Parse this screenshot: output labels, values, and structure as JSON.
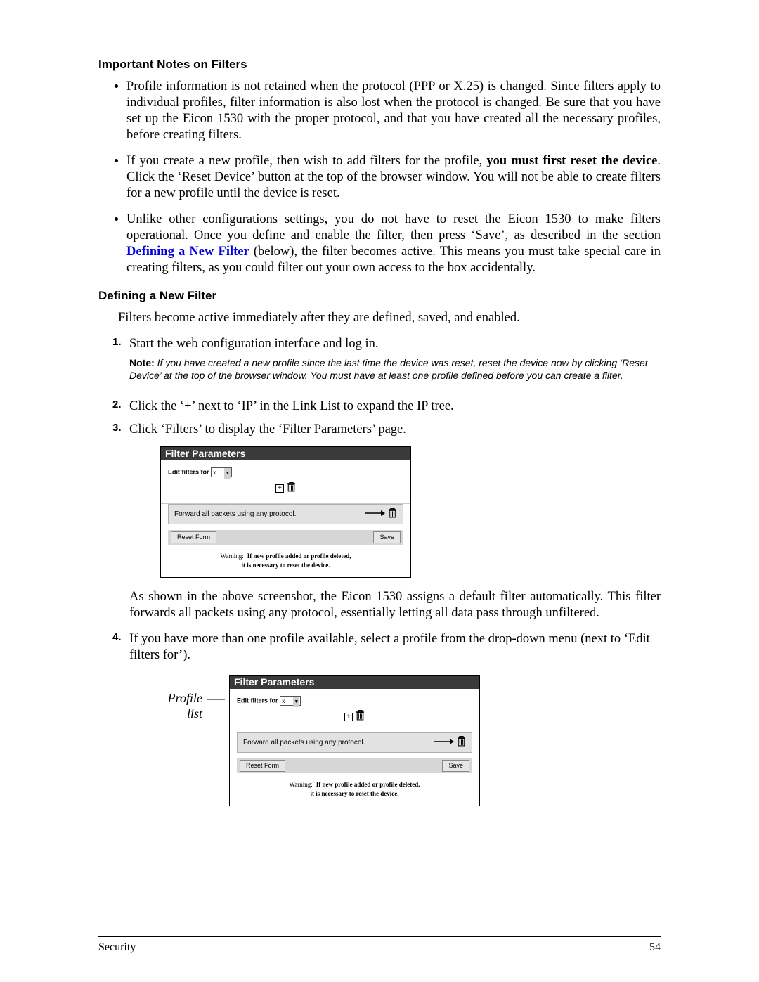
{
  "headings": {
    "notes": "Important Notes on Filters",
    "defining": "Defining a New Filter"
  },
  "bullets": [
    {
      "text": "Profile information is not retained when the protocol (PPP or X.25) is changed. Since filters apply to individual profiles, filter information is also lost when the protocol is changed. Be sure that you have set up the Eicon 1530 with the proper protocol, and that you have created all the necessary profiles, before creating filters."
    },
    {
      "pre": "If you create a new profile, then wish to add filters for the profile, ",
      "bold": "you must first reset the device",
      "post": ". Click the ‘Reset Device’ button at the top of the browser window. You will not be able to create filters for a new profile until the device is reset."
    },
    {
      "pre": "Unlike other configurations settings, you do not have to reset the Eicon 1530 to make filters operational. Once you define and enable the filter, then press ‘Save’, as described in the section ",
      "link": "Defining a New Filter",
      "post": " (below), the filter becomes active. This means you must take special care in creating filters, as you could filter out your own access to the box accidentally."
    }
  ],
  "defining_intro": "Filters become active immediately after they are defined, saved, and enabled.",
  "steps": {
    "1": "Start the web configuration interface and log in.",
    "note": {
      "label": "Note:",
      "text": "If you have created a new profile since the last time the device was reset, reset the device now by clicking ‘Reset Device’ at the top of the browser window. You must have at least one profile defined before you can create a filter."
    },
    "2": "Click the ‘+’ next to ‘IP’ in the Link List to expand the IP tree.",
    "3": "Click ‘Filters’ to display the ‘Filter Parameters’ page.",
    "3_after": "As shown in the above screenshot, the Eicon 1530 assigns a default filter automatically. This filter forwards all packets using any protocol, essentially letting all data pass through unfiltered.",
    "4": "If you have more than one profile available, select a profile from the drop-down menu (next to ‘Edit filters for’)."
  },
  "panel": {
    "title": "Filter Parameters",
    "edit_label": "Edit filters for",
    "profile": "x",
    "rule": "Forward all packets using any protocol.",
    "reset": "Reset Form",
    "save": "Save",
    "warn_label": "Warning:",
    "warn1": "If new profile added or profile deleted,",
    "warn2": "it is necessary to reset the device."
  },
  "fig2_caption": "Profile list",
  "footer": {
    "section": "Security",
    "page": "54"
  }
}
